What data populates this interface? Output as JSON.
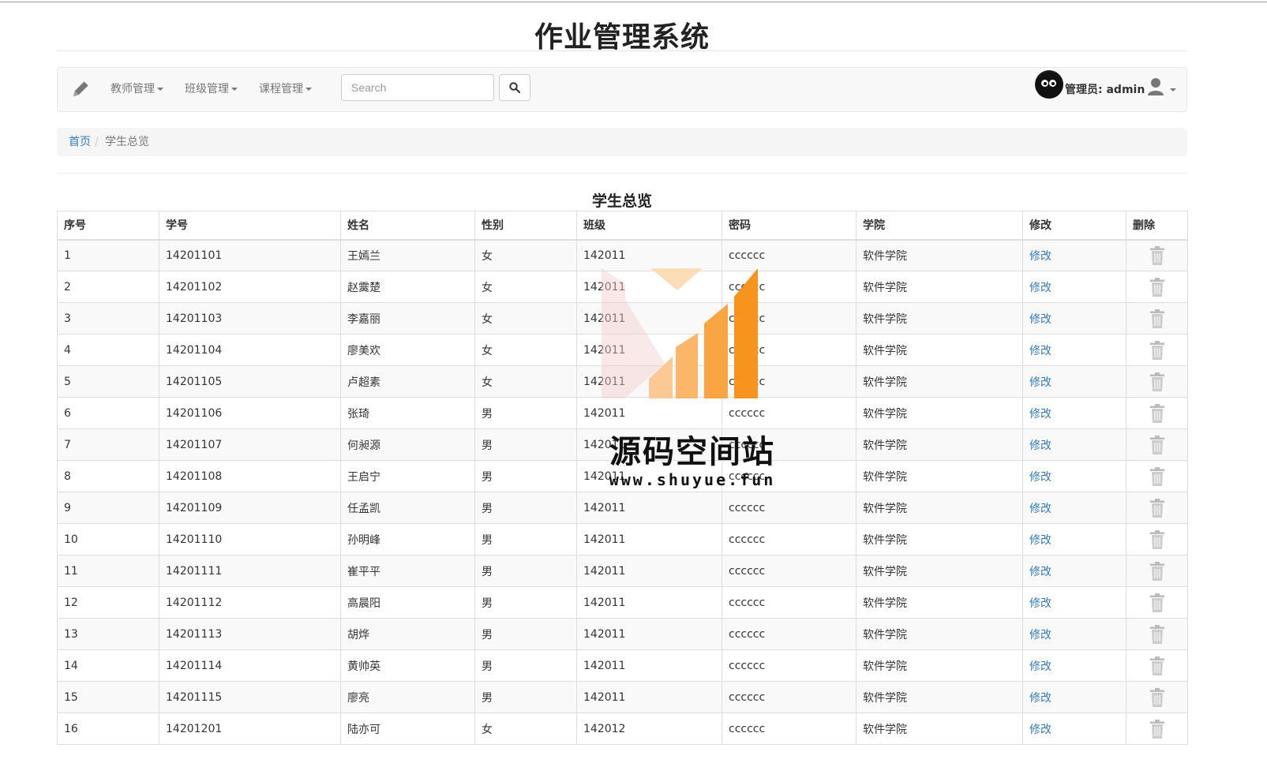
{
  "app": {
    "title": "作业管理系统"
  },
  "nav": {
    "menus": [
      {
        "label": "教师管理"
      },
      {
        "label": "班级管理"
      },
      {
        "label": "课程管理"
      }
    ],
    "search_placeholder": "Search",
    "admin_label": "管理员: admin"
  },
  "breadcrumb": {
    "home": "首页",
    "separator": "/",
    "current": "学生总览"
  },
  "table": {
    "title": "学生总览",
    "headers": [
      "序号",
      "学号",
      "姓名",
      "性别",
      "班级",
      "密码",
      "学院",
      "修改",
      "删除"
    ],
    "edit_label": "修改",
    "rows": [
      [
        "1",
        "14201101",
        "王嫣兰",
        "女",
        "142011",
        "cccccc",
        "软件学院"
      ],
      [
        "2",
        "14201102",
        "赵霙楚",
        "女",
        "142011",
        "cccccc",
        "软件学院"
      ],
      [
        "3",
        "14201103",
        "李嘉丽",
        "女",
        "142011",
        "cccccc",
        "软件学院"
      ],
      [
        "4",
        "14201104",
        "廖美欢",
        "女",
        "142011",
        "cccccc",
        "软件学院"
      ],
      [
        "5",
        "14201105",
        "卢超素",
        "女",
        "142011",
        "cccccc",
        "软件学院"
      ],
      [
        "6",
        "14201106",
        "张琦",
        "男",
        "142011",
        "cccccc",
        "软件学院"
      ],
      [
        "7",
        "14201107",
        "何昶源",
        "男",
        "142011",
        "cccccc",
        "软件学院"
      ],
      [
        "8",
        "14201108",
        "王启宁",
        "男",
        "142011",
        "cccccc",
        "软件学院"
      ],
      [
        "9",
        "14201109",
        "任孟凯",
        "男",
        "142011",
        "cccccc",
        "软件学院"
      ],
      [
        "10",
        "14201110",
        "孙明峰",
        "男",
        "142011",
        "cccccc",
        "软件学院"
      ],
      [
        "11",
        "14201111",
        "崔平平",
        "男",
        "142011",
        "cccccc",
        "软件学院"
      ],
      [
        "12",
        "14201112",
        "高晨阳",
        "男",
        "142011",
        "cccccc",
        "软件学院"
      ],
      [
        "13",
        "14201113",
        "胡烨",
        "男",
        "142011",
        "cccccc",
        "软件学院"
      ],
      [
        "14",
        "14201114",
        "黄帅英",
        "男",
        "142011",
        "cccccc",
        "软件学院"
      ],
      [
        "15",
        "14201115",
        "廖亮",
        "男",
        "142011",
        "cccccc",
        "软件学院"
      ],
      [
        "16",
        "14201201",
        "陆亦可",
        "女",
        "142012",
        "cccccc",
        "软件学院"
      ]
    ]
  },
  "watermark": {
    "name": "源码空间站",
    "url": "www.shuyue.fun"
  },
  "colors": {
    "link": "#337ab7",
    "navbar_bg": "#f8f8f8",
    "stripe": "#f9f9f9",
    "watermark_orange": "#f7941d"
  },
  "icons": [
    "pencil-icon",
    "caret-down-icon",
    "search-icon",
    "user-icon",
    "trash-icon"
  ]
}
